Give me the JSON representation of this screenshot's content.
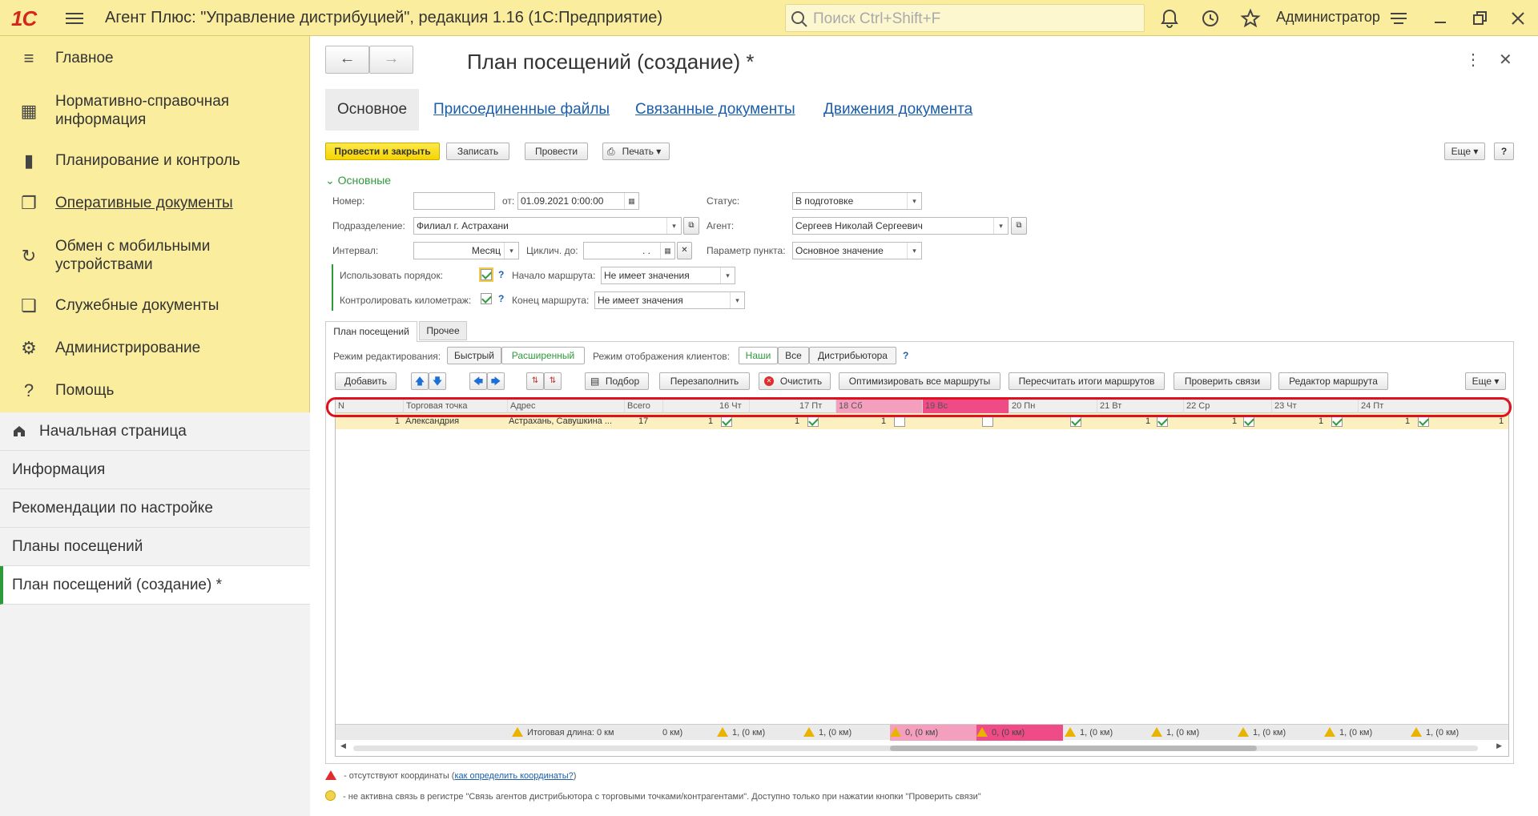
{
  "app": {
    "logo": "1С",
    "title": "Агент Плюс: \"Управление дистрибуцией\", редакция 1.16  (1С:Предприятие)",
    "search_placeholder": "Поиск Ctrl+Shift+F",
    "user": "Администратор"
  },
  "sidebar": {
    "items": [
      {
        "label": "Главное",
        "icon": "menu-list-icon"
      },
      {
        "label": "Нормативно-справочная информация",
        "icon": "grid-books-icon"
      },
      {
        "label": "Планирование и контроль",
        "icon": "bar-chart-icon"
      },
      {
        "label": "Оперативные документы",
        "icon": "documents-icon"
      },
      {
        "label": "Обмен с мобильными устройствами",
        "icon": "sync-icon"
      },
      {
        "label": "Служебные документы",
        "icon": "service-docs-icon"
      },
      {
        "label": "Администрирование",
        "icon": "gear-icon"
      },
      {
        "label": "Помощь",
        "icon": "help-icon"
      }
    ],
    "open_windows": [
      {
        "label": "Начальная страница"
      },
      {
        "label": "Информация"
      },
      {
        "label": "Рекомендации по настройке"
      },
      {
        "label": "Планы посещений"
      },
      {
        "label": "План посещений  (создание) *"
      }
    ]
  },
  "doc": {
    "title": "План посещений  (создание) *",
    "tabs": [
      "Основное",
      "Присоединенные файлы",
      "Связанные документы",
      "Движения документа"
    ],
    "toolbar": {
      "post_close": "Провести и закрыть",
      "save": "Записать",
      "post": "Провести",
      "print": "Печать",
      "more": "Еще",
      "help": "?"
    },
    "section": "Основные",
    "fields": {
      "number_label": "Номер:",
      "number_value": "",
      "from_label": "от:",
      "from_value": "01.09.2021  0:00:00",
      "status_label": "Статус:",
      "status_value": "В подготовке",
      "division_label": "Подразделение:",
      "division_value": "Филиал г. Астрахани",
      "agent_label": "Агент:",
      "agent_value": "Сергеев Николай Сергеевич",
      "interval_label": "Интервал:",
      "interval_value": "Месяц",
      "cycle_label": "Циклич. до:",
      "cycle_value": " .  .",
      "point_param_label": "Параметр пункта:",
      "point_param_value": "Основное значение",
      "use_order_label": "Использовать порядок:",
      "route_start_label": "Начало маршрута:",
      "route_start_value": "Не имеет значения",
      "control_km_label": "Контролировать километраж:",
      "route_end_label": "Конец маршрута:",
      "route_end_value": "Не имеет значения",
      "q": "?"
    },
    "inner_tabs": [
      "План посещений",
      "Прочее"
    ],
    "edit_mode_label": "Режим редактирования:",
    "edit_modes": [
      "Быстрый",
      "Расширенный"
    ],
    "display_mode_label": "Режим отображения клиентов:",
    "display_modes": [
      "Наши",
      "Все",
      "Дистрибьютора"
    ],
    "grid_toolbar": {
      "add": "Добавить",
      "pick": "Подбор",
      "refill": "Перезаполнить",
      "clear": "Очистить",
      "optimize": "Оптимизировать все маршруты",
      "recalc": "Пересчитать итоги маршрутов",
      "check": "Проверить связи",
      "route_editor": "Редактор маршрута",
      "more": "Еще"
    },
    "grid": {
      "columns": [
        "N",
        "Торговая точка",
        "Адрес",
        "Всего"
      ],
      "days": [
        "16 Чт",
        "17 Пт",
        "18 Сб",
        "19 Вс",
        "20 Пн",
        "21 Вт",
        "22 Ср",
        "23 Чт",
        "24 Пт"
      ],
      "rows": [
        {
          "n": "1",
          "point": "Александрия",
          "address": "Астрахань, Савушкина ...",
          "total": "17",
          "day_counts": [
            "1",
            "1",
            "1",
            "",
            "",
            "1",
            "1",
            "1",
            "1"
          ],
          "day_checks": [
            true,
            true,
            false,
            false,
            true,
            true,
            true,
            true,
            true
          ],
          "last_count": "1"
        }
      ],
      "footer_total": "Итоговая длина: 0 км",
      "footer_cut": "0 км)",
      "footer_days": [
        "1, (0 км)",
        "1, (0 км)",
        "0, (0 км)",
        "0, (0 км)",
        "1, (0 км)",
        "1, (0 км)",
        "1, (0 км)",
        "1, (0 км)",
        "1, (0 км)"
      ]
    },
    "notes": {
      "no_coords": " - отсутствуют координаты (",
      "no_coords_link": "как определить координаты?",
      "no_coords_end": ")",
      "inactive_link": " - не активна связь в регистре \"Связь агентов дистрибьютора с торговыми точками/контрагентами\". Доступно только при нажатии кнопки \"Проверить связи\""
    },
    "colors": {
      "weekend_sat": "#f59fbe",
      "weekend_sun": "#ef4b86",
      "accent_green": "#2e9b3b",
      "highlight_red": "#e0101e"
    }
  }
}
